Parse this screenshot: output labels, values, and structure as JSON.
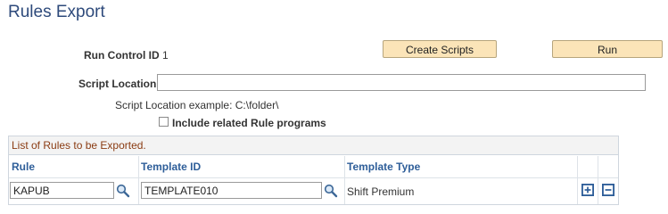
{
  "page": {
    "title": "Rules Export"
  },
  "run_control": {
    "label": "Run Control ID",
    "value": "1"
  },
  "buttons": {
    "create_scripts": "Create Scripts",
    "run": "Run"
  },
  "script_location": {
    "label": "Script Location",
    "value": "",
    "example": "Script Location example: C:\\folder\\"
  },
  "include_related": {
    "label": "Include related Rule programs",
    "checked": false
  },
  "grid": {
    "title": "List of Rules to be Exported.",
    "columns": {
      "rule": "Rule",
      "template_id": "Template ID",
      "template_type": "Template Type"
    },
    "rows": [
      {
        "rule": "KAPUB",
        "template_id": "TEMPLATE010",
        "template_type": "Shift Premium"
      }
    ]
  },
  "colors": {
    "title": "#2e4a7b",
    "grid_title": "#8a3b12",
    "header": "#2e5e99",
    "button_bg": "#fbe4b8"
  }
}
